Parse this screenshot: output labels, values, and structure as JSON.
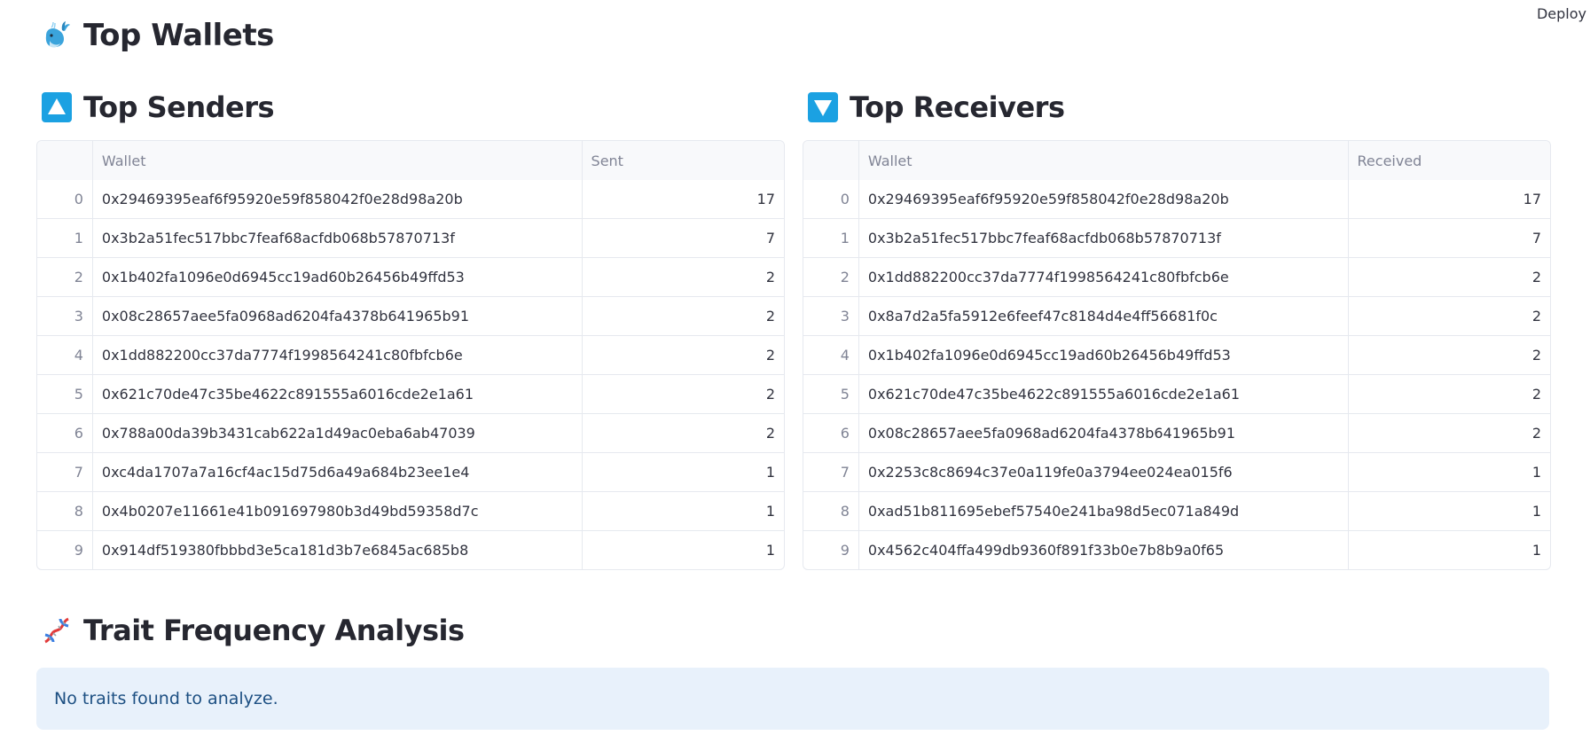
{
  "toolbar": {
    "deploy_label": "Deploy"
  },
  "header": {
    "title": "Top Wallets",
    "icon": "whale-icon"
  },
  "senders": {
    "title": "Top Senders",
    "icon": "up-arrow-button-icon",
    "columns": [
      "",
      "Wallet",
      "Sent"
    ],
    "rows": [
      {
        "idx": "0",
        "wallet": "0x29469395eaf6f95920e59f858042f0e28d98a20b",
        "value": "17"
      },
      {
        "idx": "1",
        "wallet": "0x3b2a51fec517bbc7feaf68acfdb068b57870713f",
        "value": "7"
      },
      {
        "idx": "2",
        "wallet": "0x1b402fa1096e0d6945cc19ad60b26456b49ffd53",
        "value": "2"
      },
      {
        "idx": "3",
        "wallet": "0x08c28657aee5fa0968ad6204fa4378b641965b91",
        "value": "2"
      },
      {
        "idx": "4",
        "wallet": "0x1dd882200cc37da7774f1998564241c80fbfcb6e",
        "value": "2"
      },
      {
        "idx": "5",
        "wallet": "0x621c70de47c35be4622c891555a6016cde2e1a61",
        "value": "2"
      },
      {
        "idx": "6",
        "wallet": "0x788a00da39b3431cab622a1d49ac0eba6ab47039",
        "value": "2"
      },
      {
        "idx": "7",
        "wallet": "0xc4da1707a7a16cf4ac15d75d6a49a684b23ee1e4",
        "value": "1"
      },
      {
        "idx": "8",
        "wallet": "0x4b0207e11661e41b091697980b3d49bd59358d7c",
        "value": "1"
      },
      {
        "idx": "9",
        "wallet": "0x914df519380fbbbd3e5ca181d3b7e6845ac685b8",
        "value": "1"
      }
    ]
  },
  "receivers": {
    "title": "Top Receivers",
    "icon": "down-arrow-button-icon",
    "columns": [
      "",
      "Wallet",
      "Received"
    ],
    "rows": [
      {
        "idx": "0",
        "wallet": "0x29469395eaf6f95920e59f858042f0e28d98a20b",
        "value": "17"
      },
      {
        "idx": "1",
        "wallet": "0x3b2a51fec517bbc7feaf68acfdb068b57870713f",
        "value": "7"
      },
      {
        "idx": "2",
        "wallet": "0x1dd882200cc37da7774f1998564241c80fbfcb6e",
        "value": "2"
      },
      {
        "idx": "3",
        "wallet": "0x8a7d2a5fa5912e6feef47c8184d4e4ff56681f0c",
        "value": "2"
      },
      {
        "idx": "4",
        "wallet": "0x1b402fa1096e0d6945cc19ad60b26456b49ffd53",
        "value": "2"
      },
      {
        "idx": "5",
        "wallet": "0x621c70de47c35be4622c891555a6016cde2e1a61",
        "value": "2"
      },
      {
        "idx": "6",
        "wallet": "0x08c28657aee5fa0968ad6204fa4378b641965b91",
        "value": "2"
      },
      {
        "idx": "7",
        "wallet": "0x2253c8c8694c37e0a119fe0a3794ee024ea015f6",
        "value": "1"
      },
      {
        "idx": "8",
        "wallet": "0xad51b811695ebef57540e241ba98d5ec071a849d",
        "value": "1"
      },
      {
        "idx": "9",
        "wallet": "0x4562c404ffa499db9360f891f33b0e7b8b9a0f65",
        "value": "1"
      }
    ]
  },
  "traits": {
    "title": "Trait Frequency Analysis",
    "icon": "dna-icon",
    "message": "No traits found to analyze."
  },
  "colors": {
    "accent_blue": "#1ba1e2",
    "info_bg": "#e8f1fb",
    "info_text": "#1c4f82"
  }
}
